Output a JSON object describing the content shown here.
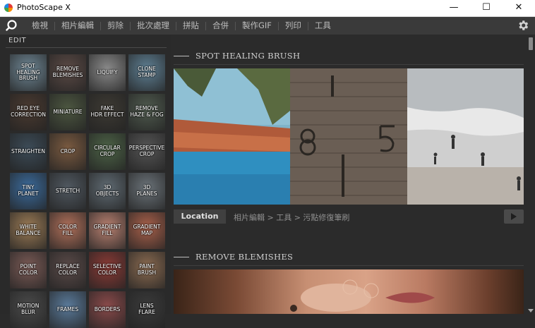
{
  "window": {
    "title": "PhotoScape X",
    "minimize": "—",
    "maximize": "☐",
    "close": "✕"
  },
  "menu": {
    "items": [
      "檢視",
      "相片編輯",
      "剪除",
      "批次處理",
      "拼貼",
      "合併",
      "製作GIF",
      "列印",
      "工具"
    ]
  },
  "left": {
    "edit_label": "EDIT",
    "tools": [
      {
        "label": "SPOT\nHEALING\nBRUSH",
        "color": "#6f8795"
      },
      {
        "label": "REMOVE\nBLEMISHES",
        "color": "#5b4a45"
      },
      {
        "label": "LIQUIFY",
        "color": "#8a8a8a"
      },
      {
        "label": "CLONE\nSTAMP",
        "color": "#5e7f93"
      },
      {
        "label": "RED EYE\nCORRECTION",
        "color": "#4a3a30"
      },
      {
        "label": "MINIATURE",
        "color": "#4c5640"
      },
      {
        "label": "FAKE\nHDR EFFECT",
        "color": "#3d3a33"
      },
      {
        "label": "REMOVE\nHAZE & FOG",
        "color": "#4f5a4e"
      },
      {
        "label": "STRAIGHTEN",
        "color": "#3c4b57"
      },
      {
        "label": "CROP",
        "color": "#7a5a40"
      },
      {
        "label": "CIRCULAR\nCROP",
        "color": "#4c6246"
      },
      {
        "label": "PERSPECTIVE\nCROP",
        "color": "#555555"
      },
      {
        "label": "TINY\nPLANET",
        "color": "#3b6a9a"
      },
      {
        "label": "STRETCH",
        "color": "#505860"
      },
      {
        "label": "3D\nOBJECTS",
        "color": "#5f6a72"
      },
      {
        "label": "3D\nPLANES",
        "color": "#6a7278"
      },
      {
        "label": "WHITE\nBALANCE",
        "color": "#9a7a55"
      },
      {
        "label": "COLOR\nFILL",
        "color": "#b0705a"
      },
      {
        "label": "GRADIENT\nFILL",
        "color": "#b88070"
      },
      {
        "label": "GRADIENT\nMAP",
        "color": "#a8604a"
      },
      {
        "label": "POINT\nCOLOR",
        "color": "#7a5a55"
      },
      {
        "label": "REPLACE\nCOLOR",
        "color": "#5a4a48"
      },
      {
        "label": "SELECTIVE\nCOLOR",
        "color": "#8a3a35"
      },
      {
        "label": "PAINT\nBRUSH",
        "color": "#8a6a50"
      },
      {
        "label": "MOTION\nBLUR",
        "color": "#4a4a4a"
      },
      {
        "label": "FRAMES",
        "color": "#5a7a9a"
      },
      {
        "label": "BORDERS",
        "color": "#8a4a4a"
      },
      {
        "label": "LENS\nFLARE",
        "color": "#3a3a3a"
      }
    ]
  },
  "content": {
    "section1_title": "SPOT HEALING BRUSH",
    "location_label": "Location",
    "breadcrumb": "相片編輯 > 工具 > 污點修復筆刷",
    "section2_title": "REMOVE BLEMISHES"
  }
}
